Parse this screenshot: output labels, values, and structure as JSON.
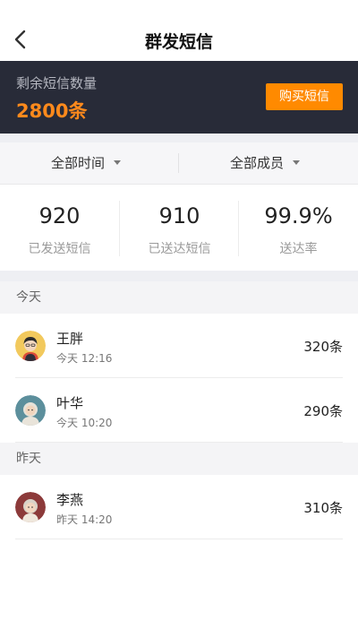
{
  "navbar": {
    "title": "群发短信",
    "back_icon": "chevron-left-icon"
  },
  "balance": {
    "label": "剩余短信数量",
    "value": "2800条",
    "buy_label": "购买短信",
    "accent": "#ff8a00",
    "bg": "#282b38"
  },
  "filters": {
    "time": "全部时间",
    "member": "全部成员"
  },
  "stats": [
    {
      "value": "920",
      "label": "已发送短信"
    },
    {
      "value": "910",
      "label": "已送达短信"
    },
    {
      "value": "99.9%",
      "label": "送达率"
    }
  ],
  "sections": [
    {
      "title": "今天",
      "items": [
        {
          "name": "王胖",
          "time": "今天 12:16",
          "count": "320条",
          "avatar": "avatar-icon"
        },
        {
          "name": "叶华",
          "time": "今天 10:20",
          "count": "290条",
          "avatar": "avatar-icon"
        }
      ]
    },
    {
      "title": "昨天",
      "items": [
        {
          "name": "李燕",
          "time": "昨天 14:20",
          "count": "310条",
          "avatar": "avatar-icon"
        }
      ]
    }
  ]
}
